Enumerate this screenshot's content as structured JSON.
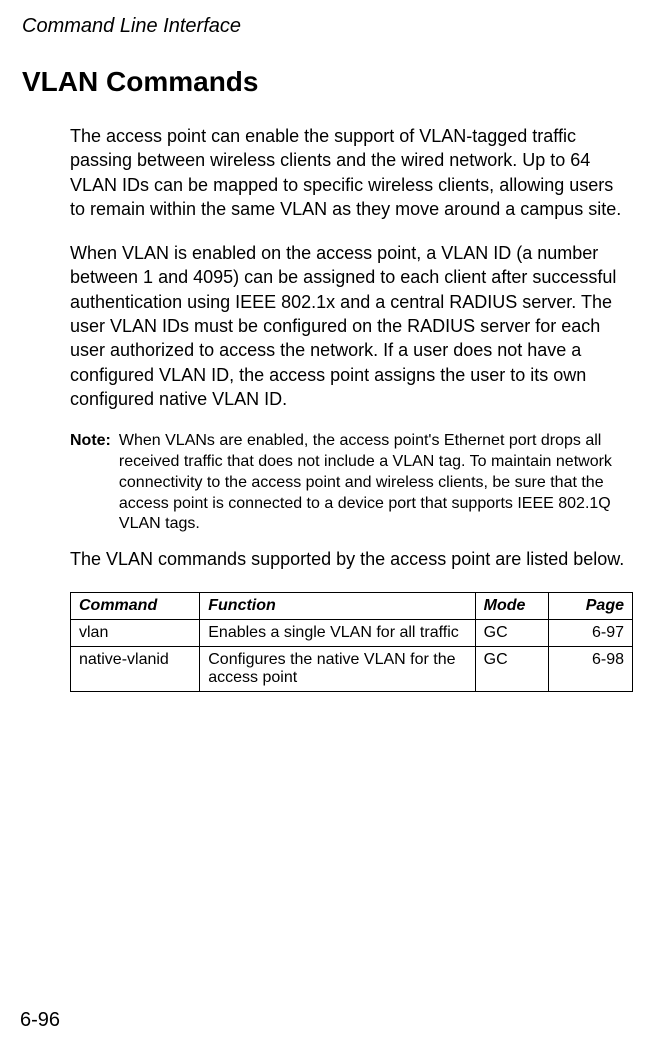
{
  "header": {
    "section": "Command Line Interface"
  },
  "title": "VLAN Commands",
  "paragraphs": {
    "p1": "The access point can enable the support of VLAN-tagged traffic passing between wireless clients and the wired network. Up to 64 VLAN IDs can be mapped to specific wireless clients, allowing users to remain within the same VLAN as they move around a campus site.",
    "p2": "When VLAN is enabled on the access point, a VLAN ID (a number between 1 and 4095) can be assigned to each client after successful authentication using IEEE 802.1x and a central RADIUS server. The user VLAN IDs must be configured on the RADIUS server for each user authorized to access the network. If a user does not have a configured VLAN ID, the access point assigns the user to its own configured native VLAN ID.",
    "p3": "The VLAN commands supported by the access point are listed below."
  },
  "note": {
    "label": "Note:",
    "text": "When VLANs are enabled, the access point's Ethernet port drops all received traffic that does not include a VLAN tag. To maintain network connectivity to the access point and wireless clients, be sure that the access point is connected to a device port that supports IEEE 802.1Q VLAN tags."
  },
  "table": {
    "headers": {
      "command": "Command",
      "function": "Function",
      "mode": "Mode",
      "page": "Page"
    },
    "rows": [
      {
        "command": "vlan",
        "function": "Enables a single VLAN for all traffic",
        "mode": "GC",
        "page": "6-97"
      },
      {
        "command": "native-vlanid",
        "function": "Configures the native VLAN for the access point",
        "mode": "GC",
        "page": "6-98"
      }
    ]
  },
  "footer": {
    "page_number": "6-96"
  }
}
